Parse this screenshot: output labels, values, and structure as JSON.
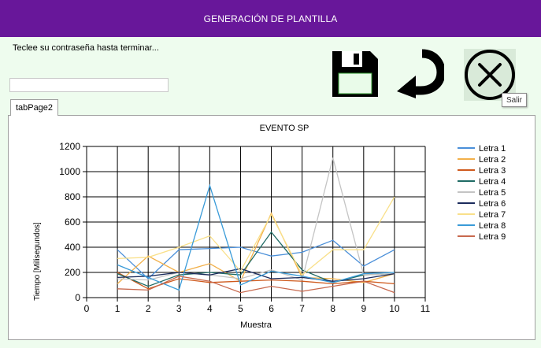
{
  "window": {
    "title": "GENERACIÓN DE PLANTILLA"
  },
  "form": {
    "instruction": "Teclee su contraseña hasta terminar...",
    "password_value": ""
  },
  "toolbar": {
    "save_icon": "floppy-disk-icon",
    "undo_icon": "curved-arrow-icon",
    "exit_icon": "circle-x-icon",
    "exit_tooltip": "Salir"
  },
  "tabs": [
    {
      "label": "tabPage2"
    }
  ],
  "colors": {
    "titlebar": "#68179a",
    "background": "#eefcee",
    "series": [
      "#4a8fd9",
      "#f2b04a",
      "#cf5a1d",
      "#1f6b65",
      "#c4c4c4",
      "#1b2b5c",
      "#f9e08a",
      "#3a9bd8",
      "#c8694e"
    ]
  },
  "chart_data": {
    "type": "line",
    "title": "EVENTO SP",
    "xlabel": "Muestra",
    "ylabel": "Tiempo [Milisegundos]",
    "xlim": [
      0,
      11
    ],
    "ylim": [
      0,
      1200
    ],
    "xticks": [
      "0",
      "1",
      "2",
      "3",
      "4",
      "5",
      "6",
      "7",
      "8",
      "9",
      "10",
      "11"
    ],
    "yticks": [
      "0",
      "200",
      "400",
      "600",
      "800",
      "1000",
      "1200"
    ],
    "grid": true,
    "legend_position": "right",
    "x": [
      1,
      2,
      3,
      4,
      5,
      6,
      7,
      8,
      9,
      10
    ],
    "series": [
      {
        "name": "Letra 1",
        "values": [
          380,
          150,
          380,
          390,
          400,
          330,
          360,
          455,
          250,
          380
        ]
      },
      {
        "name": "Letra 2",
        "values": [
          110,
          330,
          200,
          270,
          130,
          670,
          160,
          150,
          120,
          190
        ]
      },
      {
        "name": "Letra 3",
        "values": [
          200,
          70,
          150,
          120,
          130,
          140,
          130,
          110,
          130,
          110
        ]
      },
      {
        "name": "Letra 4",
        "values": [
          190,
          90,
          180,
          200,
          180,
          520,
          220,
          120,
          180,
          190
        ]
      },
      {
        "name": "Letra 5",
        "values": [
          150,
          140,
          200,
          180,
          150,
          220,
          140,
          1110,
          180,
          190
        ]
      },
      {
        "name": "Letra 6",
        "values": [
          160,
          170,
          200,
          180,
          230,
          150,
          160,
          130,
          150,
          190
        ]
      },
      {
        "name": "Letra 7",
        "values": [
          310,
          320,
          400,
          490,
          210,
          660,
          180,
          380,
          380,
          800
        ]
      },
      {
        "name": "Letra 8",
        "values": [
          260,
          160,
          60,
          890,
          100,
          210,
          170,
          120,
          190,
          200
        ]
      },
      {
        "name": "Letra 9",
        "values": [
          70,
          60,
          170,
          130,
          40,
          90,
          50,
          90,
          130,
          40
        ]
      }
    ]
  }
}
